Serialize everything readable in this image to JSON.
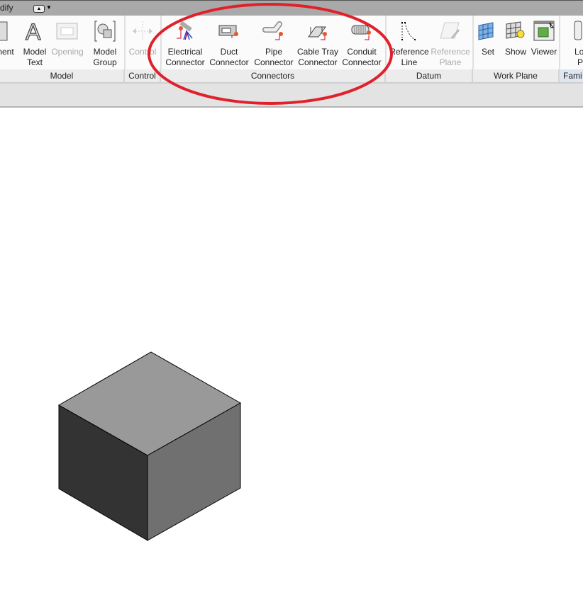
{
  "topbar": {
    "tab": "dify"
  },
  "ribbon": {
    "buttons": [
      {
        "l1": "nent",
        "l2": ""
      },
      {
        "l1": "Model",
        "l2": "Text"
      },
      {
        "l1": "Opening",
        "l2": ""
      },
      {
        "l1": "Model",
        "l2": "Group"
      },
      {
        "l1": "Control",
        "l2": ""
      },
      {
        "l1": "Electrical",
        "l2": "Connector"
      },
      {
        "l1": "Duct",
        "l2": "Connector"
      },
      {
        "l1": "Pipe",
        "l2": "Connector"
      },
      {
        "l1": "Cable Tray",
        "l2": "Connector"
      },
      {
        "l1": "Conduit",
        "l2": "Connector"
      },
      {
        "l1": "Reference",
        "l2": "Line"
      },
      {
        "l1": "Reference",
        "l2": "Plane"
      },
      {
        "l1": "Set",
        "l2": ""
      },
      {
        "l1": "Show",
        "l2": ""
      },
      {
        "l1": "Viewer",
        "l2": ""
      },
      {
        "l1": "Loa",
        "l2": "Pr"
      }
    ],
    "panels": [
      "Model",
      "Control",
      "Connectors",
      "Datum",
      "Work Plane",
      "Fami"
    ]
  },
  "colors": {
    "highlight": "#e0202a",
    "cube_top": "#999999",
    "cube_left": "#333333",
    "cube_right": "#707070"
  }
}
